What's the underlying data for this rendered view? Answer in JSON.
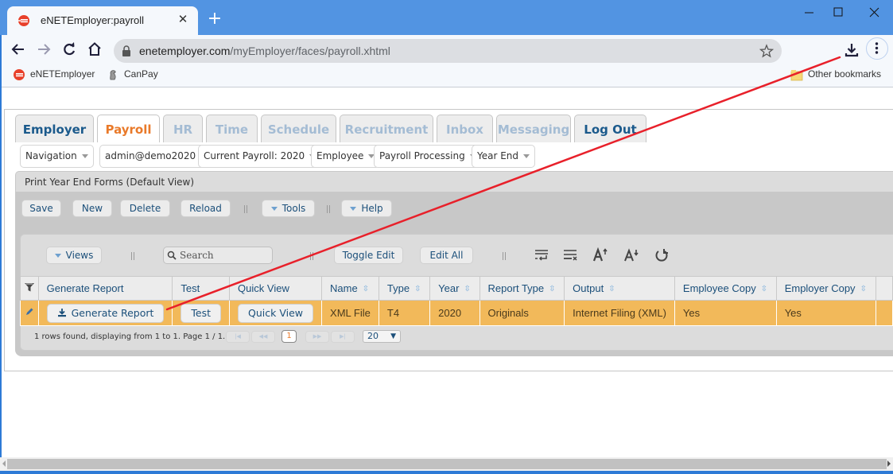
{
  "browser": {
    "tab_title": "eNETEmployer:payroll",
    "url_host": "enetemployer.com",
    "url_path": "/myEmployer/faces/payroll.xhtml",
    "bookmarks": [
      {
        "label": "eNETEmployer",
        "icon": "enet-logo-icon"
      },
      {
        "label": "CanPay",
        "icon": "canpay-logo-icon"
      }
    ],
    "other_bookmarks": "Other bookmarks",
    "new_tab_symbol": "+",
    "close_tab_symbol": "✕"
  },
  "module_tabs": [
    {
      "label": "Employer",
      "state": "enabled"
    },
    {
      "label": "Payroll",
      "state": "active"
    },
    {
      "label": "HR",
      "state": "disabled"
    },
    {
      "label": "Time",
      "state": "disabled"
    },
    {
      "label": "Schedule",
      "state": "disabled"
    },
    {
      "label": "Recruitment",
      "state": "disabled"
    },
    {
      "label": "Inbox",
      "state": "disabled"
    },
    {
      "label": "Messaging",
      "state": "disabled"
    },
    {
      "label": "Log Out",
      "state": "enabled"
    }
  ],
  "nav_menus": [
    {
      "label": "Navigation"
    },
    {
      "label": "admin@demo2020"
    },
    {
      "label": "Current Payroll: 2020"
    },
    {
      "label": "Employee"
    },
    {
      "label": "Payroll Processing"
    },
    {
      "label": "Year End"
    }
  ],
  "panel": {
    "title": "Print Year End Forms (Default View)",
    "toolbar": {
      "save": "Save",
      "new": "New",
      "delete": "Delete",
      "reload": "Reload",
      "tools": "Tools",
      "help": "Help"
    }
  },
  "grid": {
    "views_label": "Views",
    "search_placeholder": "Search",
    "toggle_edit": "Toggle Edit",
    "edit_all": "Edit All",
    "tool_icons": [
      "wrap-text-icon",
      "clear-format-icon",
      "font-increase-icon",
      "font-decrease-icon",
      "reset-icon"
    ],
    "columns": [
      {
        "label": "",
        "sortable": false
      },
      {
        "label": "Generate Report",
        "sortable": false
      },
      {
        "label": "Test",
        "sortable": false
      },
      {
        "label": "Quick View",
        "sortable": false
      },
      {
        "label": "Name",
        "sortable": true
      },
      {
        "label": "Type",
        "sortable": true
      },
      {
        "label": "Year",
        "sortable": true
      },
      {
        "label": "Report Type",
        "sortable": true
      },
      {
        "label": "Output",
        "sortable": true
      },
      {
        "label": "Employee Copy",
        "sortable": true
      },
      {
        "label": "Employer Copy",
        "sortable": true
      }
    ],
    "rows": [
      {
        "generate_report": "Generate Report",
        "test": "Test",
        "quick_view": "Quick View",
        "name": "XML File",
        "type": "T4",
        "year": "2020",
        "report_type": "Originals",
        "output": "Internet Filing (XML)",
        "employee_copy": "Yes",
        "employer_copy": "Yes"
      }
    ],
    "pager": {
      "summary": "1 rows found, displaying from 1 to 1. Page 1 / 1.",
      "current_page": "1",
      "page_size": "20",
      "first": "|◀",
      "prev": "◀◀",
      "next": "▶▶",
      "last": "▶|"
    }
  },
  "colors": {
    "titlebar": "#5294e2",
    "active_tab_text": "#e97a2a",
    "enabled_tab_text": "#1b5a8c",
    "disabled_tab_text": "#a4bcd4",
    "selected_row": "#f2b95a",
    "annotation_arrow": "#e8202a"
  }
}
